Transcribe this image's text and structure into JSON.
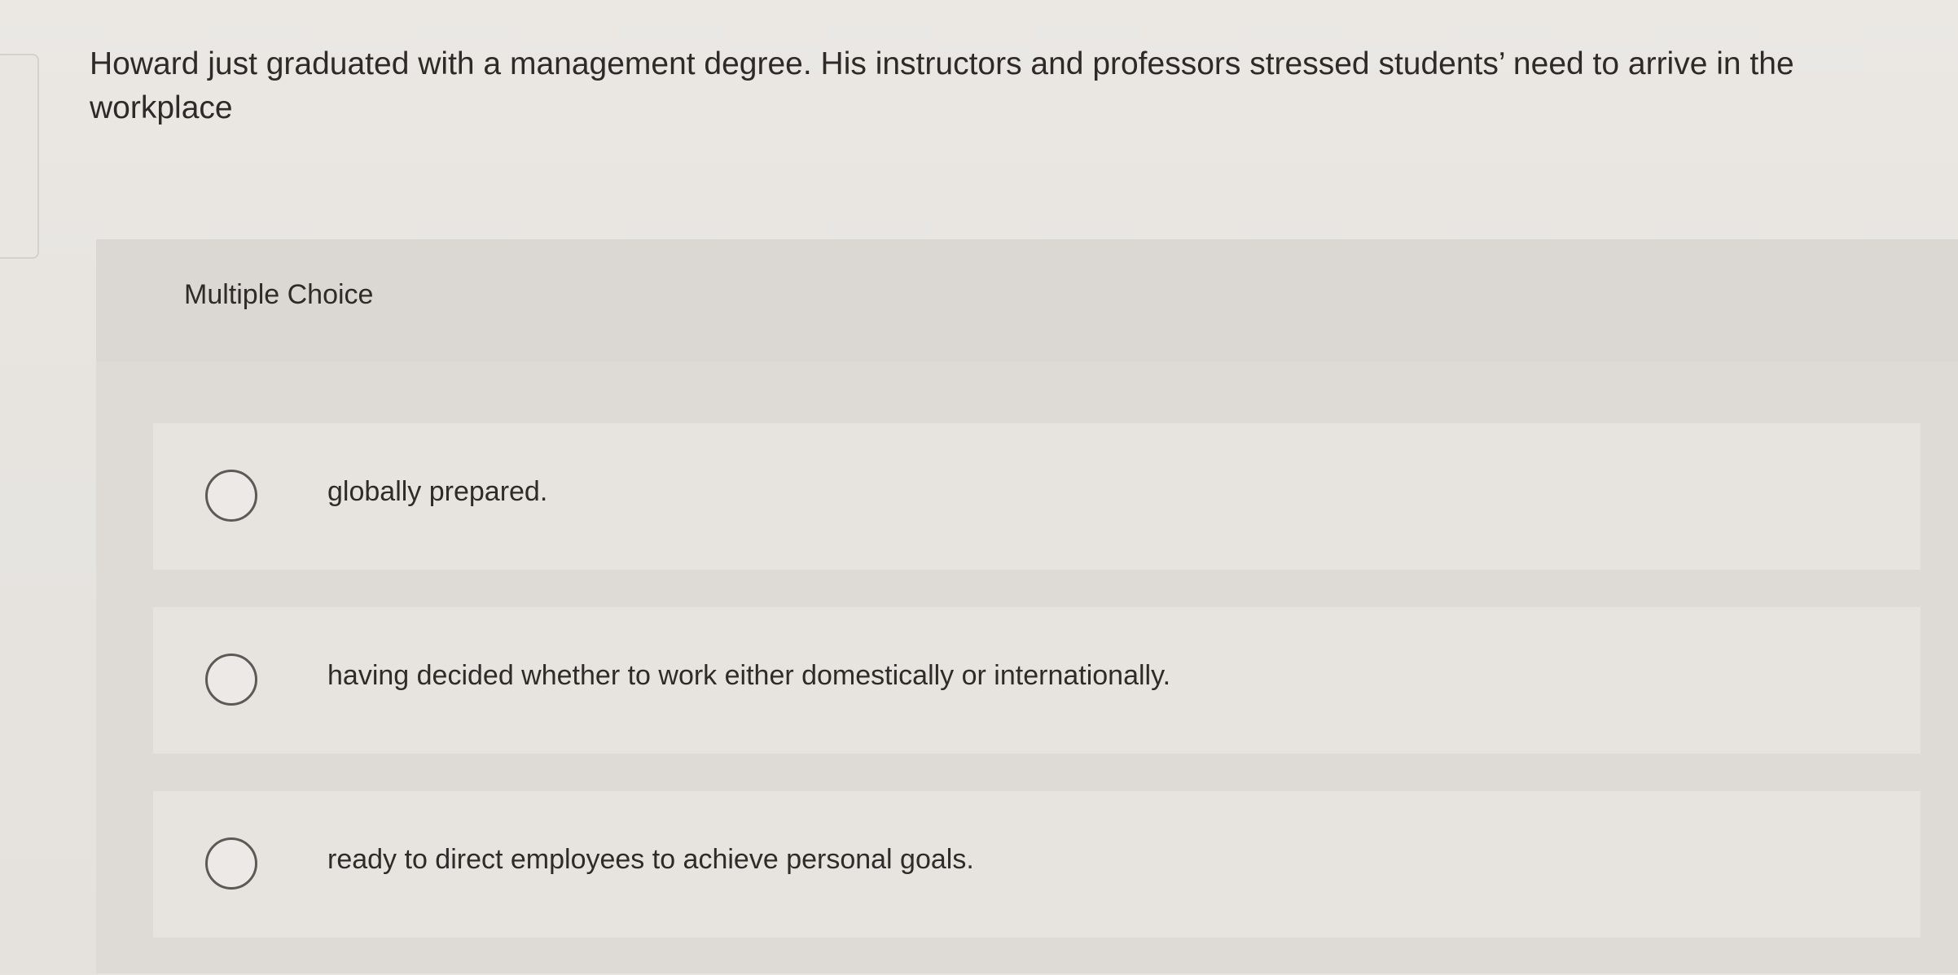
{
  "question": {
    "text": "Howard just graduated with a management degree. His instructors and professors stressed students’ need to arrive in the workplace"
  },
  "answer_section": {
    "label": "Multiple Choice",
    "options": [
      {
        "label": "globally prepared."
      },
      {
        "label": "having decided whether to work either domestically or internationally."
      },
      {
        "label": "ready to direct employees to achieve personal goals."
      }
    ]
  },
  "icons": {
    "radio": "radio-button-icon"
  }
}
